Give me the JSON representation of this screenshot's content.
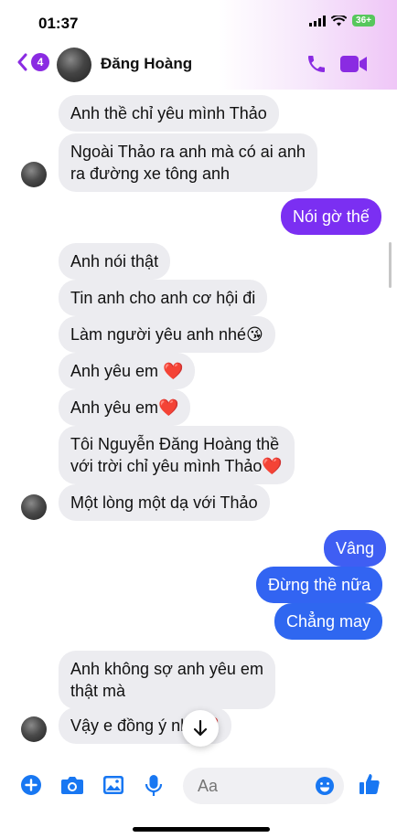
{
  "status_bar": {
    "time": "01:37",
    "battery": "36+"
  },
  "header": {
    "back_count": "4",
    "contact_name": "Đăng Hoàng"
  },
  "messages": [
    {
      "text": "Anh thề chỉ yêu mình Thảo",
      "direction": "in"
    },
    {
      "text": "Ngoài Thảo ra anh mà có ai anh\nra đường xe tông anh",
      "direction": "in"
    },
    {
      "text": "Nói gờ thế",
      "direction": "out"
    },
    {
      "text": "Anh nói thật",
      "direction": "in"
    },
    {
      "text": "Tin anh cho anh cơ hội đi",
      "direction": "in"
    },
    {
      "text": "Làm người yêu anh nhé😘",
      "direction": "in"
    },
    {
      "text": "Anh yêu em ❤️",
      "direction": "in"
    },
    {
      "text": "Anh yêu em❤️",
      "direction": "in"
    },
    {
      "text": "Tôi Nguyễn Đăng Hoàng thề\nvới trời chỉ yêu mình Thảo❤️",
      "direction": "in"
    },
    {
      "text": "Một lòng một dạ với Thảo",
      "direction": "in"
    },
    {
      "text": "Vâng",
      "direction": "out"
    },
    {
      "text": "Đừng thề nữa",
      "direction": "out"
    },
    {
      "text": "Chẳng may",
      "direction": "out"
    },
    {
      "text": "Anh không sợ anh yêu em\nthật mà",
      "direction": "in"
    },
    {
      "text": "Vậy e đồng ý nhé❤️",
      "direction": "in"
    }
  ],
  "composer": {
    "placeholder": "Aa"
  },
  "colors": {
    "accent": "#8a2be2",
    "out_top": "#6a2cf5",
    "out_bottom": "#2f67f0",
    "in_bubble": "#ececf0",
    "toolbar_icon": "#1877f2"
  },
  "icons": {
    "back": "chevron-left-icon",
    "call": "phone-icon",
    "video": "video-camera-icon",
    "scroll": "arrow-down-icon",
    "add": "plus-circle-icon",
    "camera": "camera-icon",
    "gallery": "image-icon",
    "voice": "microphone-icon",
    "emoji": "smiley-icon",
    "like": "thumbs-up-icon"
  }
}
